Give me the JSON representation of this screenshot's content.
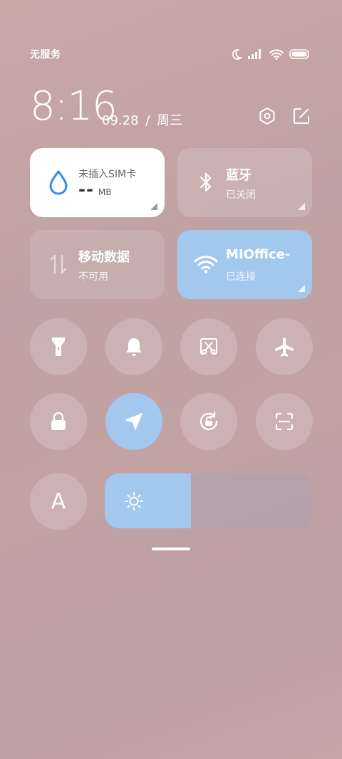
{
  "status": {
    "carrier": "无服务"
  },
  "header": {
    "time": "8:16",
    "date": "09.28",
    "separator": "/",
    "weekday": "周三"
  },
  "tiles": {
    "data_usage": {
      "title": "未插入SIM卡",
      "value": "--",
      "unit": "MB"
    },
    "bluetooth": {
      "title": "蓝牙",
      "status": "已关闭"
    },
    "mobile_data": {
      "title": "移动数据",
      "status": "不可用"
    },
    "wifi": {
      "title": "MIOffice-",
      "status": "已连接"
    }
  },
  "toggles": [
    {
      "icon": "flashlight-icon",
      "active": false
    },
    {
      "icon": "bell-icon",
      "active": false
    },
    {
      "icon": "screenshot-icon",
      "active": false
    },
    {
      "icon": "airplane-icon",
      "active": false
    },
    {
      "icon": "lock-icon",
      "active": false
    },
    {
      "icon": "location-icon",
      "active": true
    },
    {
      "icon": "rotation-lock-icon",
      "active": false
    },
    {
      "icon": "scan-icon",
      "active": false
    }
  ],
  "auto_brightness": {
    "label": "A"
  },
  "brightness": {
    "level": 0.415
  },
  "colors": {
    "accent": "#a3c8ee",
    "water": "#2d8fe6"
  }
}
